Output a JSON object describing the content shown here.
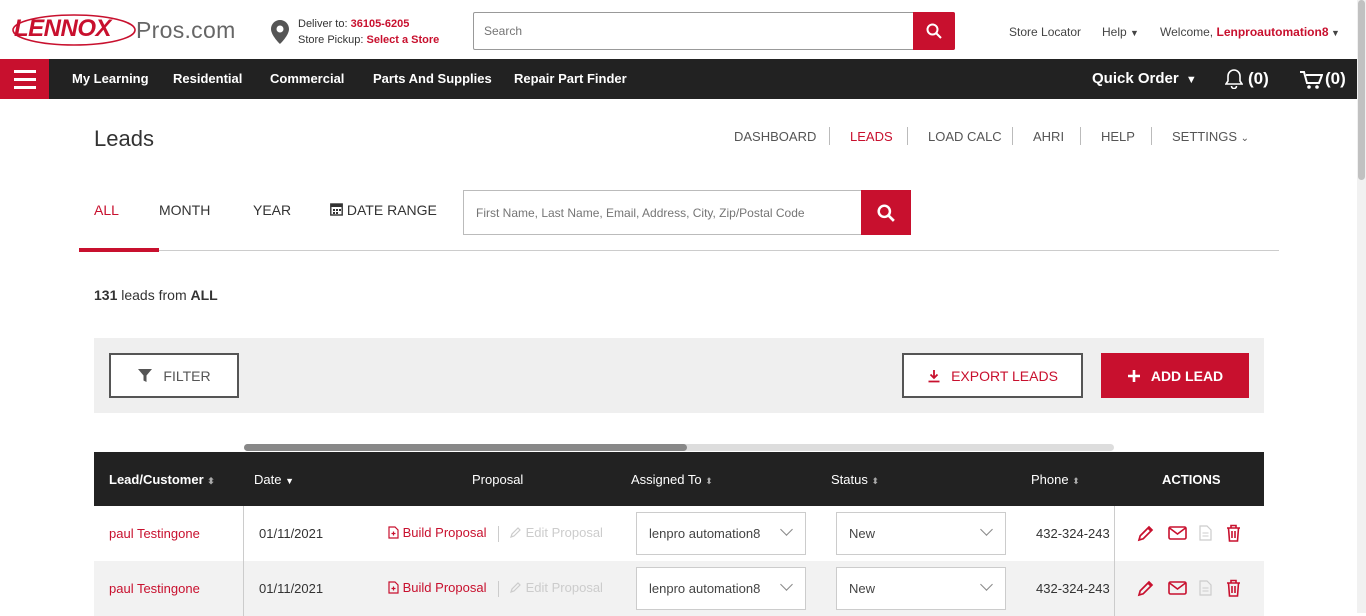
{
  "header": {
    "logo_brand": "LENNOX",
    "logo_site": "Pros.com",
    "deliver_label": "Deliver to:",
    "deliver_zip": "36105-6205",
    "pickup_label": "Store Pickup:",
    "pickup_value": "Select a Store",
    "search_placeholder": "Search",
    "store_locator": "Store Locator",
    "help": "Help",
    "welcome_label": "Welcome,",
    "user": "Lenproautomation8"
  },
  "nav": {
    "items": [
      "My Learning",
      "Residential",
      "Commercial",
      "Parts And Supplies",
      "Repair Part Finder"
    ],
    "quick_order": "Quick Order",
    "notifications": "(0)",
    "cart": "(0)"
  },
  "page": {
    "title": "Leads",
    "sublinks": [
      "DASHBOARD",
      "LEADS",
      "LOAD CALC",
      "AHRI",
      "HELP",
      "SETTINGS"
    ],
    "active_sublink": "LEADS"
  },
  "filters": {
    "tabs": [
      "ALL",
      "MONTH",
      "YEAR",
      "DATE RANGE"
    ],
    "active_tab": "ALL",
    "search_placeholder": "First Name, Last Name, Email, Address, City, Zip/Postal Code"
  },
  "summary": {
    "count": "131",
    "text": "leads from",
    "scope": "ALL"
  },
  "toolbar": {
    "filter_label": "FILTER",
    "export_label": "EXPORT LEADS",
    "add_label": "ADD LEAD"
  },
  "table": {
    "columns": [
      "Lead/Customer",
      "Date",
      "Proposal",
      "Assigned To",
      "Status",
      "Phone",
      "ACTIONS"
    ],
    "rows": [
      {
        "customer": "paul Testingone",
        "date": "01/11/2021",
        "build": "Build Proposal",
        "edit": "Edit Proposal",
        "assigned": "lenpro automation8",
        "status": "New",
        "phone": "432-324-243"
      },
      {
        "customer": "paul Testingone",
        "date": "01/11/2021",
        "build": "Build Proposal",
        "edit": "Edit Proposal",
        "assigned": "lenpro automation8",
        "status": "New",
        "phone": "432-324-243"
      }
    ]
  },
  "colors": {
    "brand_red": "#c8102e",
    "dark": "#222222"
  }
}
